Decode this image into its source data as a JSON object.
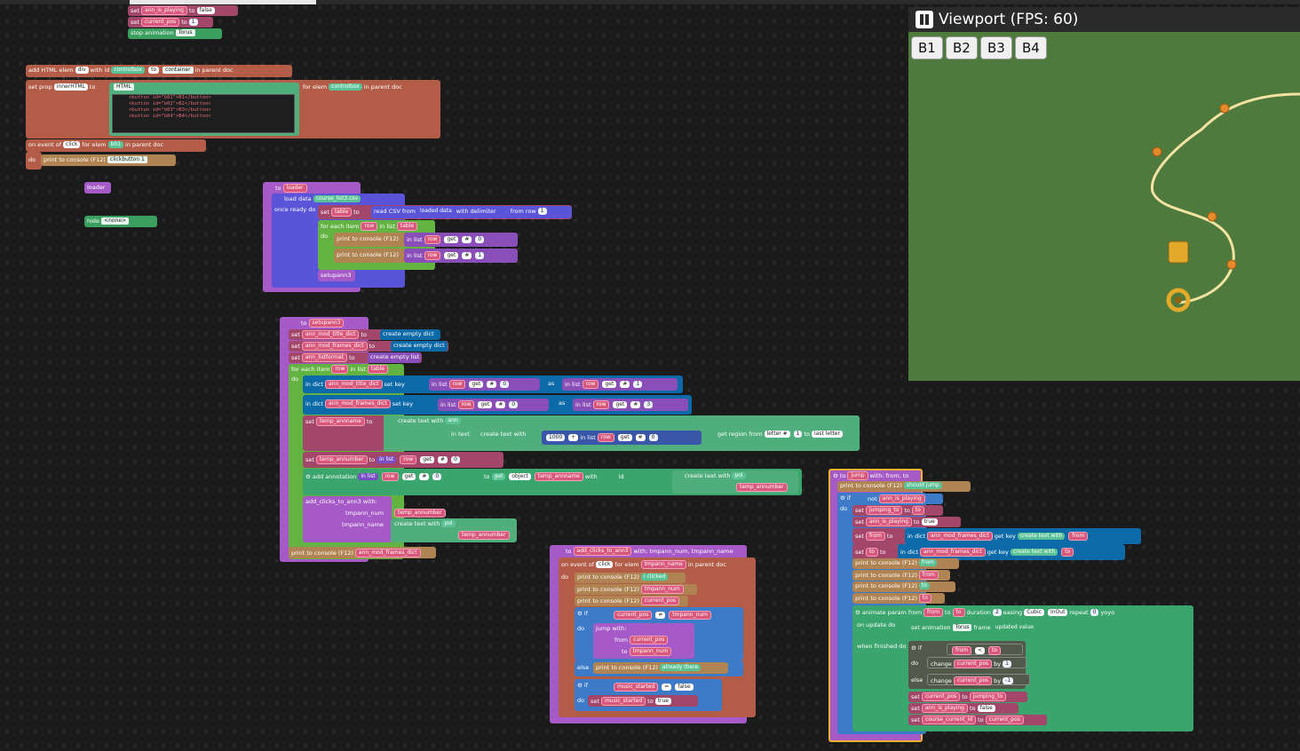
{
  "viewport": {
    "title": "Viewport (FPS: 60)",
    "buttons": [
      "B1",
      "B2",
      "B3",
      "B4"
    ]
  },
  "b_top": {
    "set": "set",
    "to": "to",
    "var1": "ann_is_playing",
    "val1": "false",
    "var2": "current_pos",
    "val2": "1",
    "stop": "stop animation",
    "stop_val": "Torus"
  },
  "b_html": {
    "add_html": "add HTML elem",
    "elem_type": "div",
    "with_id": "with id",
    "controlbox": "controlbox",
    "to": "to",
    "container": "container",
    "in_parent": "in parent doc",
    "set_prop": "set prop",
    "prop": "innerHTML",
    "to2": "to",
    "html": "HTML",
    "for_elem": "for elem",
    "in_parent2": "in parent doc",
    "code": [
      "<button id=\"b01\">B1</button>",
      "<button id=\"b02\">B2</button>",
      "<button id=\"b03\">B3</button>",
      "<button id=\"b04\">B4</button>"
    ],
    "on_event": "on event of",
    "event": "click",
    "for_elem2": "for elem",
    "b01": "b01",
    "in_parent3": "in parent doc",
    "do": "do",
    "print": "print to console (F12)",
    "click_msg": "clickbutton 1"
  },
  "b_loose": {
    "loader": "loader",
    "hide": "hide",
    "none": "<none>"
  },
  "b_loader": {
    "to": "to",
    "name": "loader",
    "load_data": "load data",
    "csv": "course_list3.csv",
    "once_ready": "once ready do",
    "set": "set",
    "table": "table",
    "to2": "to",
    "read_csv": "read CSV from",
    "loaded": "loaded data",
    "delim": "with delimiter",
    "from_row": "from row",
    "row_num": "1",
    "for_each": "for each item",
    "row": "row",
    "in_list": "in list",
    "do": "do",
    "print": "print to console (F12)",
    "get": "get",
    "hash": "#",
    "idx0": "0",
    "idx1": "1",
    "call": "setupann3"
  },
  "b_setup": {
    "to": "to",
    "name": "setupann3",
    "set": "set",
    "v1": "ann_mod_title_dict",
    "v2": "ann_mod_frames_dict",
    "v3": "ann_listformat",
    "empty_dict": "create empty dict",
    "empty_list": "create empty list",
    "for_each": "for each item",
    "row": "row",
    "in_list": "in list",
    "table": "table",
    "do": "do",
    "in_dict": "in dict",
    "set_key": "set key",
    "get": "get",
    "hash": "#",
    "as": "as",
    "i0": "0",
    "i1": "1",
    "i3": "3",
    "temp_annname": "temp_annname",
    "create_text": "create text with",
    "ann": "ann",
    "in_text": "in text",
    "num1000": "1000",
    "plus": "+",
    "get_region": "get region from",
    "letter": "letter #",
    "to_last": "to",
    "last_letter": "last letter",
    "temp_annumber": "temp_annumber",
    "add_annotation": "add annotation",
    "get_object": "get",
    "object": "object",
    "with": "with",
    "id": "id",
    "pol": "pol",
    "add_clicks": "add_clicks_to_ann3",
    "with2": "with:",
    "tmpann_num": "tmpann_num",
    "tmpann_name": "tmpann_name",
    "print": "print to console (F12)"
  },
  "b_clicks": {
    "to": "to",
    "name": "add_clicks_to_ann3",
    "with": "with: tmpann_num, tmpann_name",
    "on_event": "on event of",
    "click": "click",
    "for_elem": "for elem",
    "tmpann_name": "tmpann_name",
    "in_parent": "in parent doc",
    "do": "do",
    "print": "print to console (F12)",
    "i_clicked": "i clicked",
    "tmpann_num": "tmpann_num",
    "current_pos": "current_pos",
    "if": "if",
    "neq": "≠",
    "jump": "jump",
    "with2": "with:",
    "from": "from",
    "to2": "to",
    "else": "else",
    "already": "already there",
    "music_started": "music_started",
    "eq": "=",
    "false": "false",
    "set": "set",
    "true": "true"
  },
  "b_jump": {
    "to": "to",
    "name": "jump",
    "with": "with: from, to",
    "print": "print to console (F12)",
    "should_jump": "should jump",
    "if": "if",
    "not": "not",
    "ann_is_playing": "ann_is_playing",
    "do": "do",
    "set": "set",
    "jumping_to": "jumping_to",
    "true": "true",
    "from": "from",
    "in_dict": "in dict",
    "frames_dict": "ann_mod_frames_dict",
    "get_key": "get key",
    "create_text": "create text with",
    "animate": "animate param from",
    "duration": "duration",
    "dur_val": "2",
    "easing": "easing",
    "cubic": "Cubic",
    "inout": "InOut",
    "repeat": "repeat",
    "rep_val": "0",
    "yoyo": "yoyo",
    "on_update": "on update do",
    "set_anim": "set animation",
    "torus": "Torus",
    "frame": "frame",
    "updated": "updated value",
    "when_finished": "when finished do",
    "lt": "<",
    "change": "change",
    "current_pos": "current_pos",
    "by": "by",
    "by1": "1",
    "byn1": "-1",
    "else": "else",
    "false": "false",
    "course_current": "course_current_id"
  }
}
